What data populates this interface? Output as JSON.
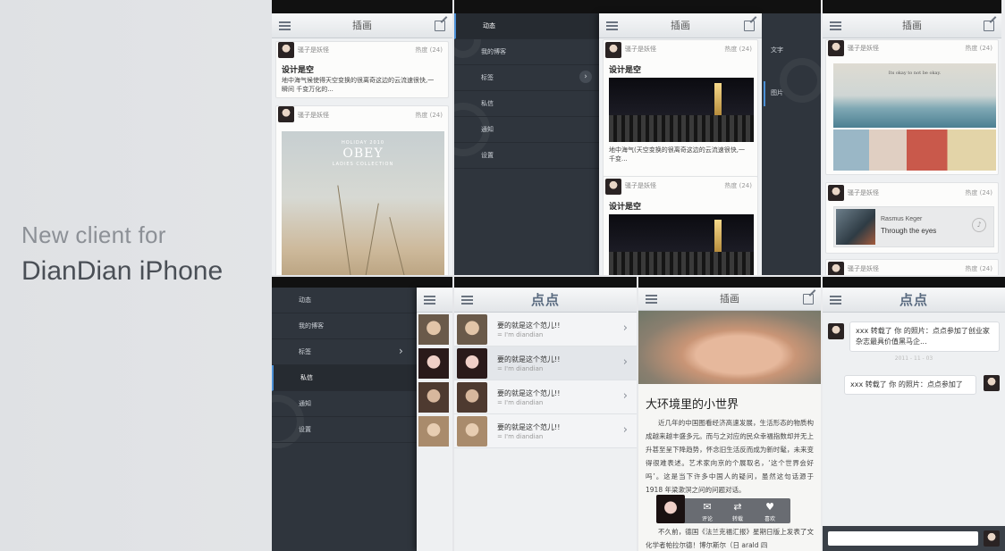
{
  "intro": {
    "line1": "New client for",
    "line2": "DianDian iPhone"
  },
  "feed": {
    "title": "插画",
    "user": "骚子是妖怪",
    "heat": "热度",
    "heat_count": "(24)",
    "post_title": "设计是空",
    "post_body_1": "地中海气候使得天空变换的很离奇这边的云流速很快,一",
    "post_body_2": "瞬间 千变万化的...",
    "poster_line1": "HOLIDAY 2010",
    "poster_line2": "OBEY",
    "poster_line3": "LADIES COLLECTION"
  },
  "feed2": {
    "post_title": "设计是空",
    "post_body_1": "地中海气(天空变换的很离奇这边的云流速很快,一",
    "post_body_2": "千变...",
    "post_title_short": "设计是"
  },
  "menu": {
    "items": [
      "动态",
      "我的博客",
      "标签",
      "私信",
      "通知",
      "设置"
    ],
    "side_tabs": [
      "文字",
      "图片"
    ]
  },
  "music_card": {
    "photo_caption": "Its okay to not be okay.",
    "artist": "Rasmus Keger",
    "track": "Through the eyes"
  },
  "messages": {
    "logo": "点点",
    "rows": [
      {
        "title": "要的就是这个范儿!!",
        "sub": "= I'm diandian"
      },
      {
        "title": "要的就是这个范儿!!",
        "sub": "= I'm diandian"
      },
      {
        "title": "要的就是这个范儿!!",
        "sub": "= I'm diandian"
      },
      {
        "title": "要的就是这个范儿!!",
        "sub": "= I'm diandian"
      }
    ]
  },
  "article": {
    "title": "插画",
    "heading": "大环境里的小世界",
    "p1": "近几年的中国图看经济高速发展，生活形态的物质构成越来越丰盛多元。而与之对应的民众幸福指数却并无上升甚至呈下降趋势，怀念旧生活反而成为新时髦，未来变得很难表述。艺术家向京的个展取名，‘这个世界会好吗’。这是当下许多中国人的疑问，虽然这句话源于 1918 年梁漱溟之问的问题对话。",
    "p2": "不久前，德国《法兰克福汇报》星期日版上发表了文化学者帕拉尔德！博尔斯尔（日 arald 四",
    "actions": [
      "评论",
      "转载",
      "喜欢"
    ]
  },
  "chat": {
    "logo": "点点",
    "bubble1": "xxx 转载了 你 的照片：点点参加了创业家杂志最具价值黑马企...",
    "timestamp": "2011 - 11 - 03",
    "bubble2": "xxx 转载了 你 的照片：点点参加了"
  },
  "colors": {
    "accent": "#4b90d6",
    "menu_bg": "#2f353d",
    "page_bg": "#e4e6e9"
  }
}
